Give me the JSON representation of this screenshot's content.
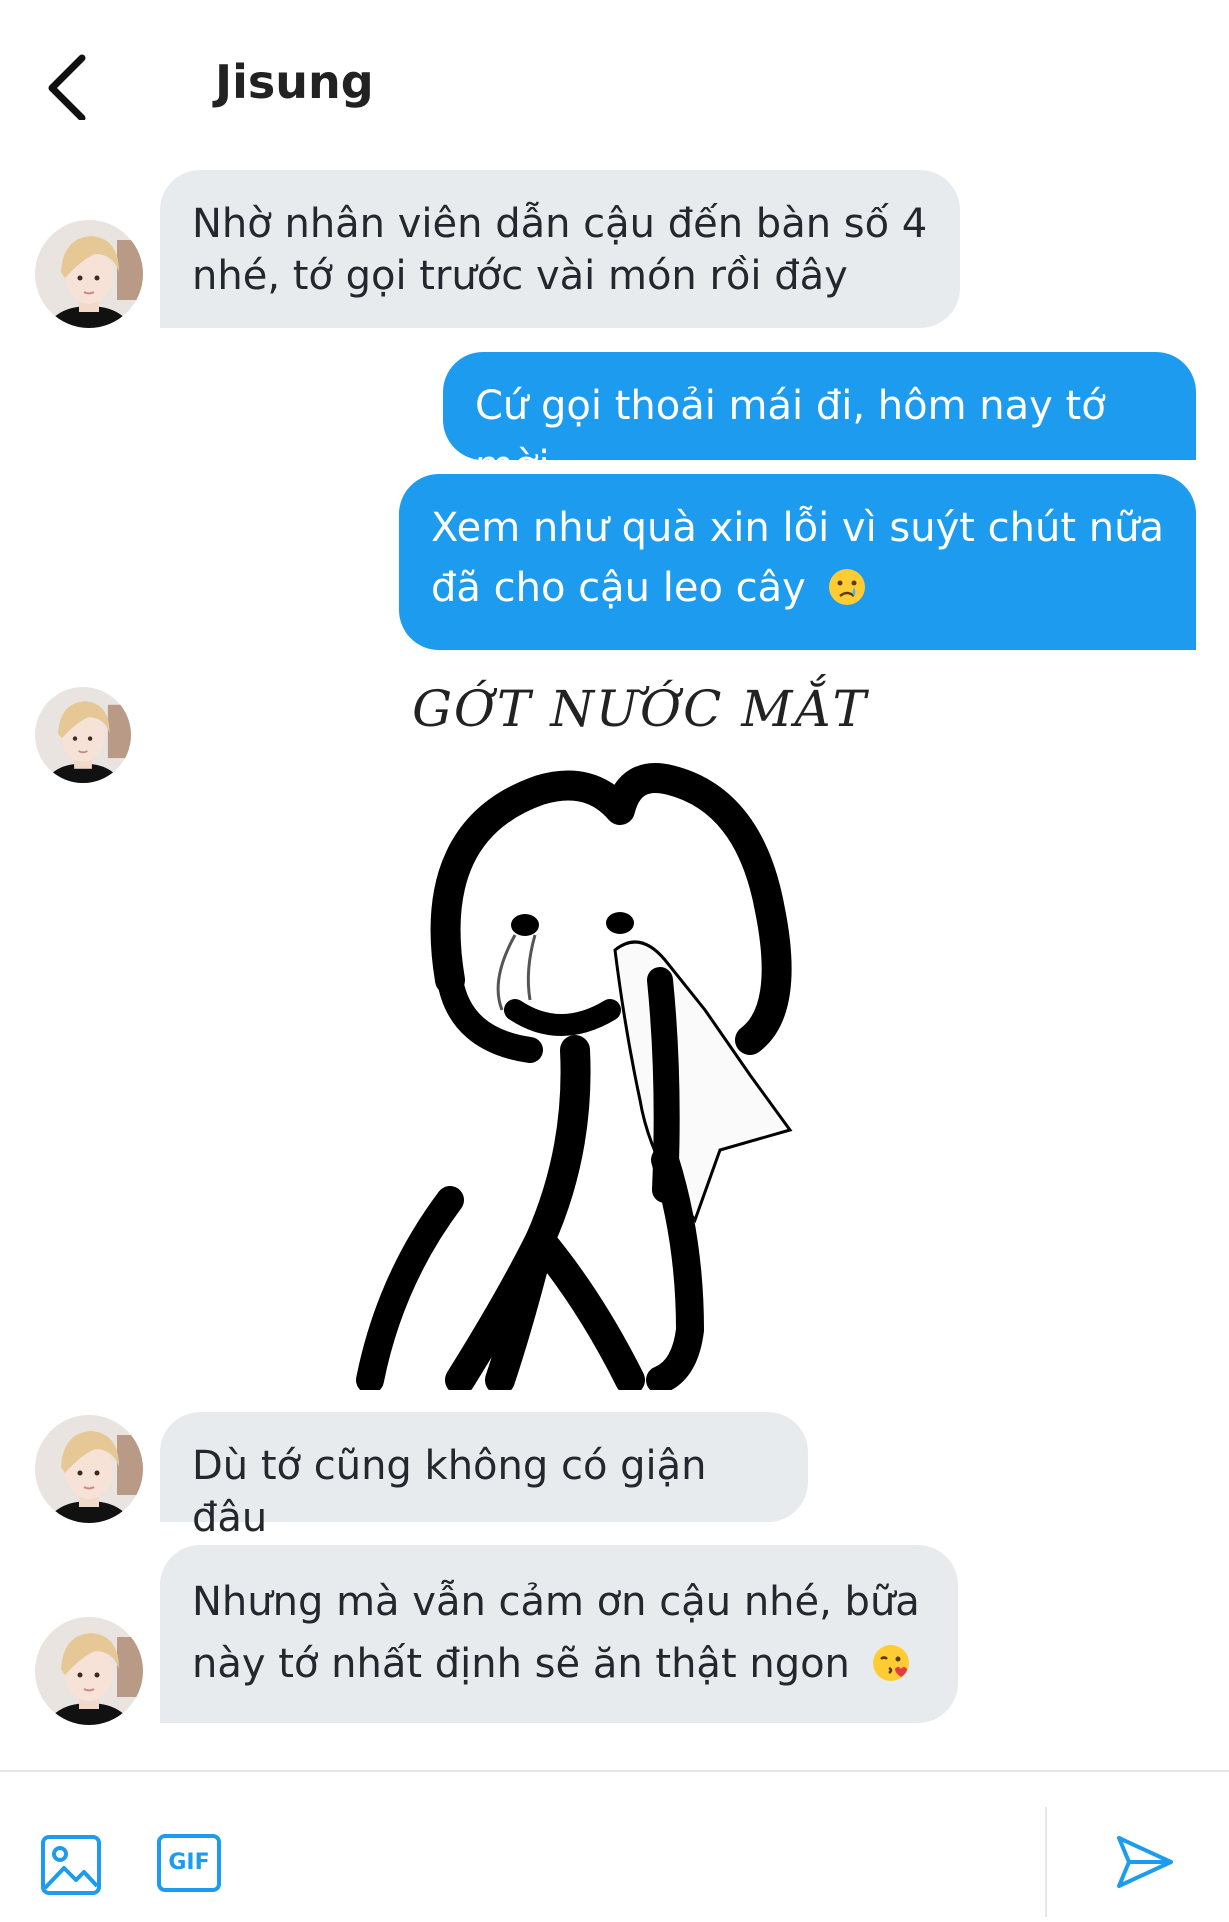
{
  "header": {
    "title": "Jisung"
  },
  "messages": [
    {
      "side": "in",
      "text_line1": "Nhờ nhân viên dẫn cậu đến bàn số 4",
      "text_line2": "nhé, tớ gọi trước vài món rồi đây"
    },
    {
      "side": "out",
      "text": "Cứ gọi thoải mái đi, hôm nay tớ mời"
    },
    {
      "side": "out",
      "text_line1": "Xem như quà xin lỗi vì suýt chút nữa",
      "text_line2": "đã cho cậu leo cây",
      "emoji": "crying-face"
    },
    {
      "side": "in",
      "type": "image",
      "caption": "GỚT NƯỚC MẮT"
    },
    {
      "side": "in",
      "text": "Dù tớ cũng không có giận đâu"
    },
    {
      "side": "in",
      "text_line1": "Nhưng mà vẫn cảm ơn cậu nhé, bữa",
      "text_line2": "này tớ nhất định sẽ ăn thật ngon",
      "emoji": "face-blowing-kiss"
    }
  ],
  "composer": {
    "image_icon": "image-icon",
    "gif_label": "GIF",
    "send_icon": "send-icon"
  },
  "colors": {
    "accent": "#1c9bef",
    "incoming_bubble": "#e8ebee"
  }
}
